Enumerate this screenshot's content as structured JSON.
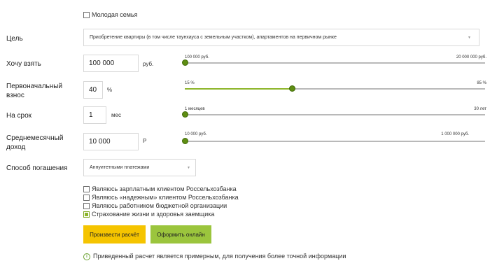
{
  "young_family": {
    "label": "Молодая семья",
    "checked": false
  },
  "purpose": {
    "label": "Цель",
    "value": "Приобретение квартиры (в том числе таунхауса с земельным участком), апартаментов на первичном рынке"
  },
  "amount": {
    "label": "Хочу взять",
    "value": "100 000",
    "unit": "руб.",
    "min_label": "100 000 руб.",
    "max_label": "20 000 000 руб.",
    "level": 0
  },
  "down_payment": {
    "label_line1": "Первоначальный",
    "label_line2": "взнос",
    "value": "40",
    "unit": "%",
    "min_label": "15 %",
    "max_label": "85 %",
    "level": 0.357
  },
  "term": {
    "label": "На срок",
    "value": "1",
    "unit": "мес",
    "min_label": "1 месяцев",
    "max_label": "30 лет",
    "level": 0
  },
  "income": {
    "label_line1": "Среднемесячный",
    "label_line2": "доход",
    "value": "10 000",
    "unit": "Р",
    "min_label": "10 000 руб.",
    "max_label": "1 000 000 руб.",
    "level": 0
  },
  "repayment": {
    "label": "Способ погашения",
    "value": "Аннуитетными платежами"
  },
  "options": [
    {
      "label": "Являюсь зарплатным клиентом Россельхозбанка",
      "checked": false
    },
    {
      "label": "Являюсь «надежным» клиентом Россельхозбанка",
      "checked": false
    },
    {
      "label": "Являюсь работником бюджетной организации",
      "checked": false
    },
    {
      "label": "Страхование жизни и здоровья заемщика",
      "checked": true
    }
  ],
  "buttons": {
    "calculate": "Произвести расчёт",
    "apply": "Оформить онлайн"
  },
  "notice": "Приведенный расчет является примерным, для получения более точной информации",
  "colors": {
    "accent": "#8db52a",
    "knob": "#5e8d12",
    "yellow_button": "#f5c400",
    "green_button": "#9bc53d"
  }
}
